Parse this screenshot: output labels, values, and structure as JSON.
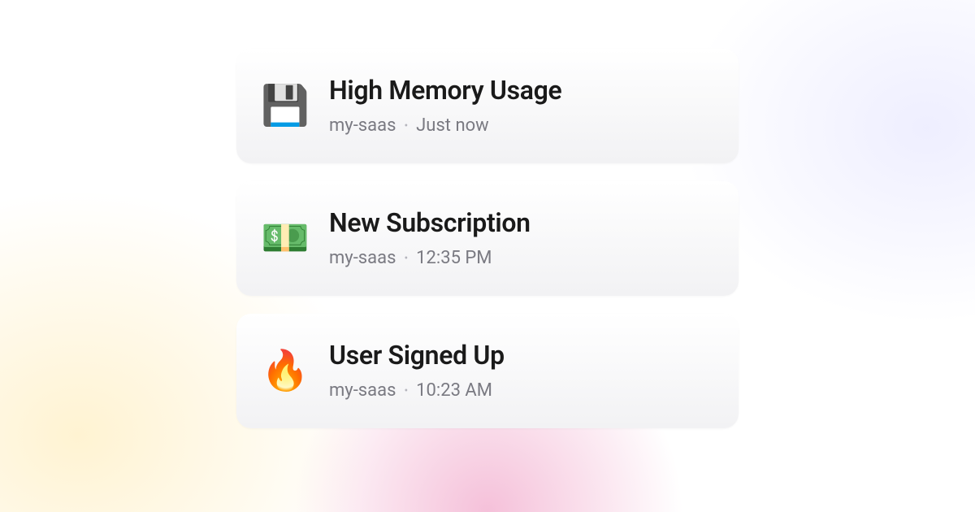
{
  "notifications": [
    {
      "icon": "💾",
      "icon_name": "floppy-disk-icon",
      "title": "High Memory Usage",
      "project": "my-saas",
      "time": "Just now"
    },
    {
      "icon": "💵",
      "icon_name": "money-icon",
      "title": "New Subscription",
      "project": "my-saas",
      "time": "12:35 PM"
    },
    {
      "icon": "🔥",
      "icon_name": "fire-icon",
      "title": "User Signed Up",
      "project": "my-saas",
      "time": "10:23 AM"
    }
  ]
}
